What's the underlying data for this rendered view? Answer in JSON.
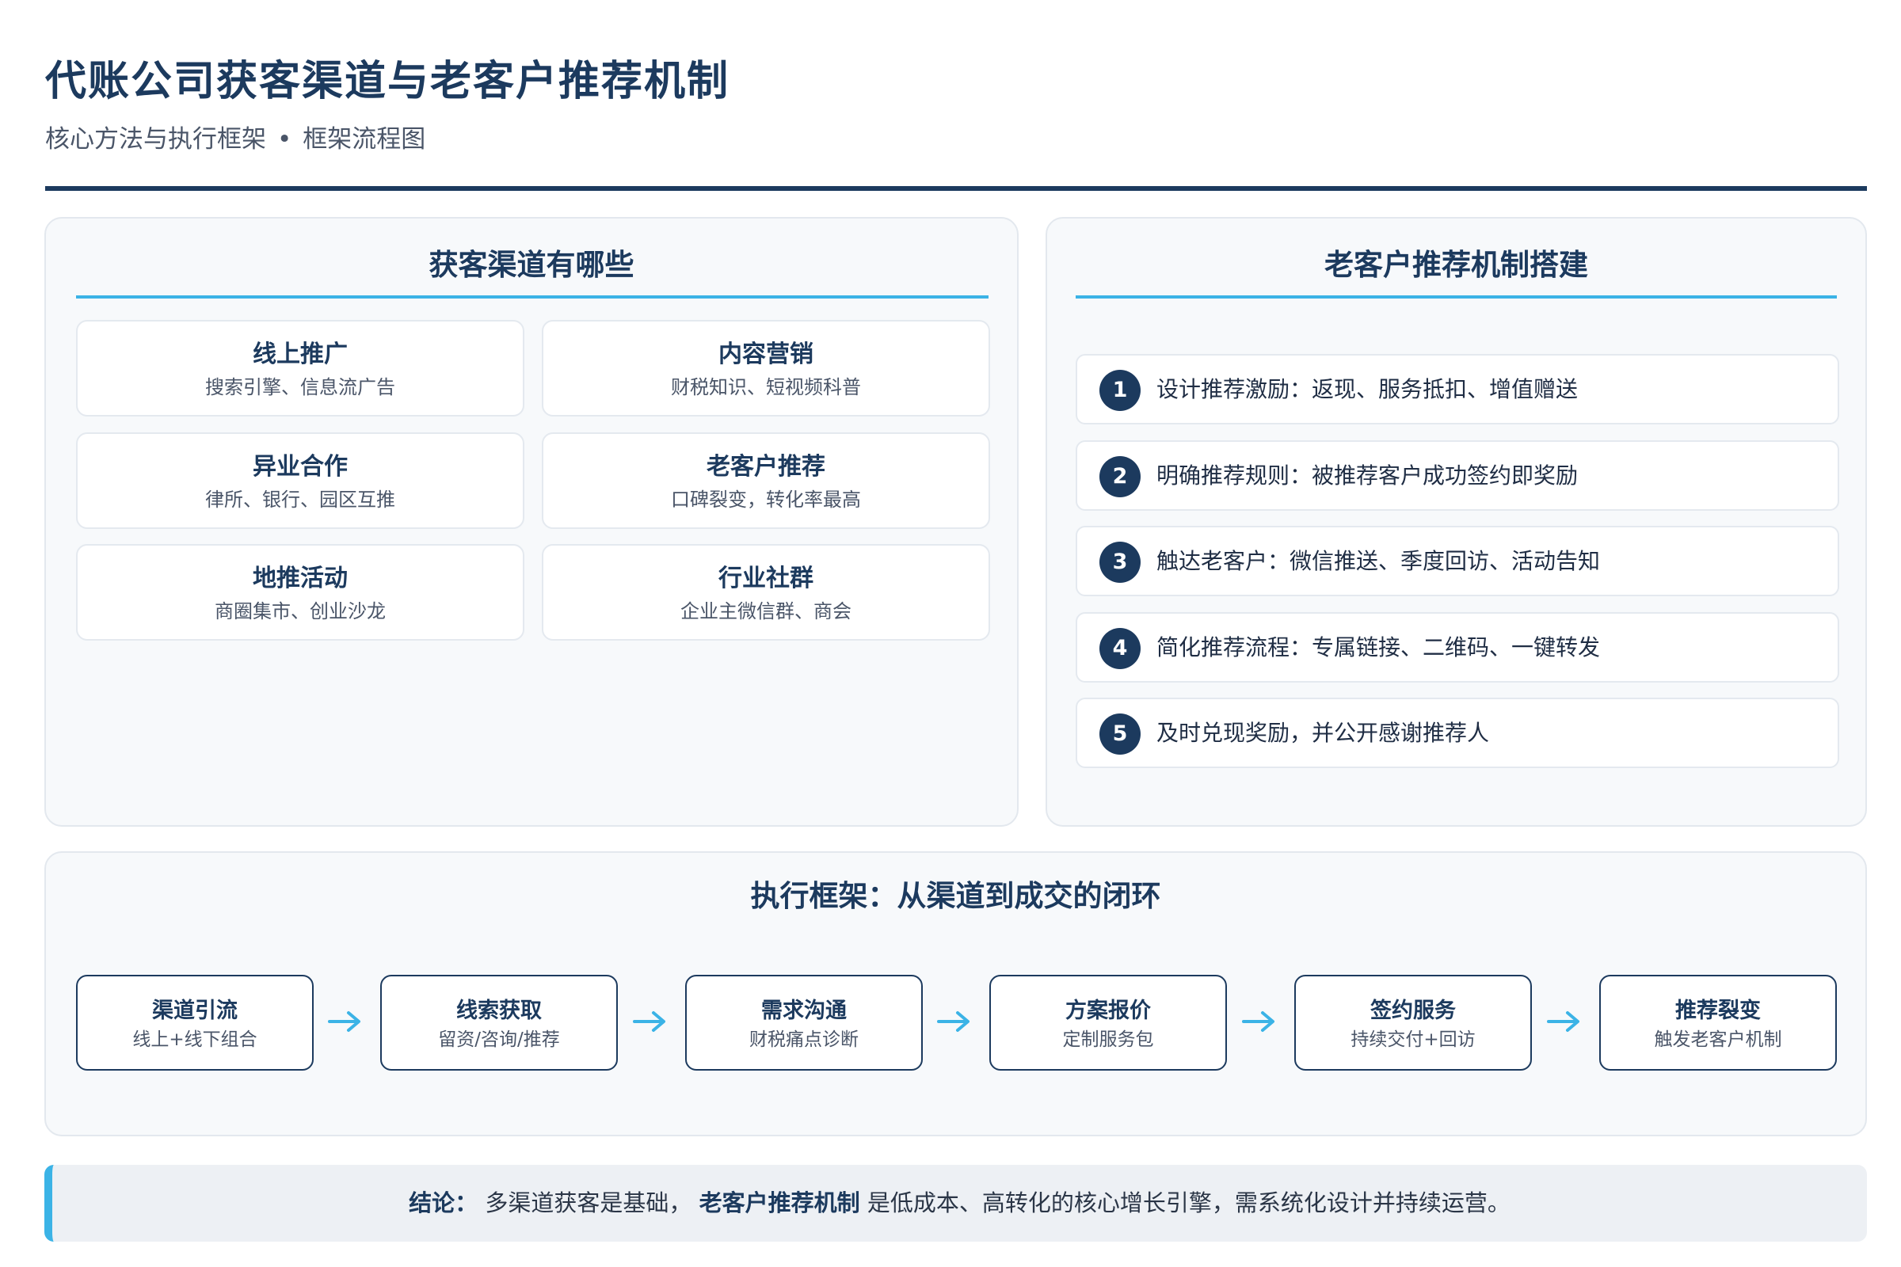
{
  "header": {
    "title": "代账公司获客渠道与老客户推荐机制",
    "subtitle_left": "核心方法与执行框架",
    "subtitle_sep": "•",
    "subtitle_right": "框架流程图"
  },
  "channels_panel": {
    "title": "获客渠道有哪些",
    "cards": [
      {
        "name": "线上推广",
        "desc": "搜索引擎、信息流广告"
      },
      {
        "name": "内容营销",
        "desc": "财税知识、短视频科普"
      },
      {
        "name": "异业合作",
        "desc": "律所、银行、园区互推"
      },
      {
        "name": "老客户推荐",
        "desc": "口碑裂变，转化率最高"
      },
      {
        "name": "地推活动",
        "desc": "商圈集市、创业沙龙"
      },
      {
        "name": "行业社群",
        "desc": "企业主微信群、商会"
      }
    ]
  },
  "referral_panel": {
    "title": "老客户推荐机制搭建",
    "steps": [
      {
        "num": "1",
        "text": "设计推荐激励：返现、服务抵扣、增值赠送"
      },
      {
        "num": "2",
        "text": "明确推荐规则：被推荐客户成功签约即奖励"
      },
      {
        "num": "3",
        "text": "触达老客户：微信推送、季度回访、活动告知"
      },
      {
        "num": "4",
        "text": "简化推荐流程：专属链接、二维码、一键转发"
      },
      {
        "num": "5",
        "text": "及时兑现奖励，并公开感谢推荐人"
      }
    ]
  },
  "flow_panel": {
    "title": "执行框架：从渠道到成交的闭环",
    "nodes": [
      {
        "name": "渠道引流",
        "desc": "线上+线下组合"
      },
      {
        "name": "线索获取",
        "desc": "留资/咨询/推荐"
      },
      {
        "name": "需求沟通",
        "desc": "财税痛点诊断"
      },
      {
        "name": "方案报价",
        "desc": "定制服务包"
      },
      {
        "name": "签约服务",
        "desc": "持续交付+回访"
      },
      {
        "name": "推荐裂变",
        "desc": "触发老客户机制"
      }
    ]
  },
  "conclusion": {
    "label": "结论：",
    "text_before": "多渠道获客是基础，",
    "emphasis": "老客户推荐机制",
    "text_after": "是低成本、高转化的核心增长引擎，需系统化设计并持续运营。"
  },
  "colors": {
    "navy": "#1c3a5e",
    "accent": "#3bb3e6"
  }
}
